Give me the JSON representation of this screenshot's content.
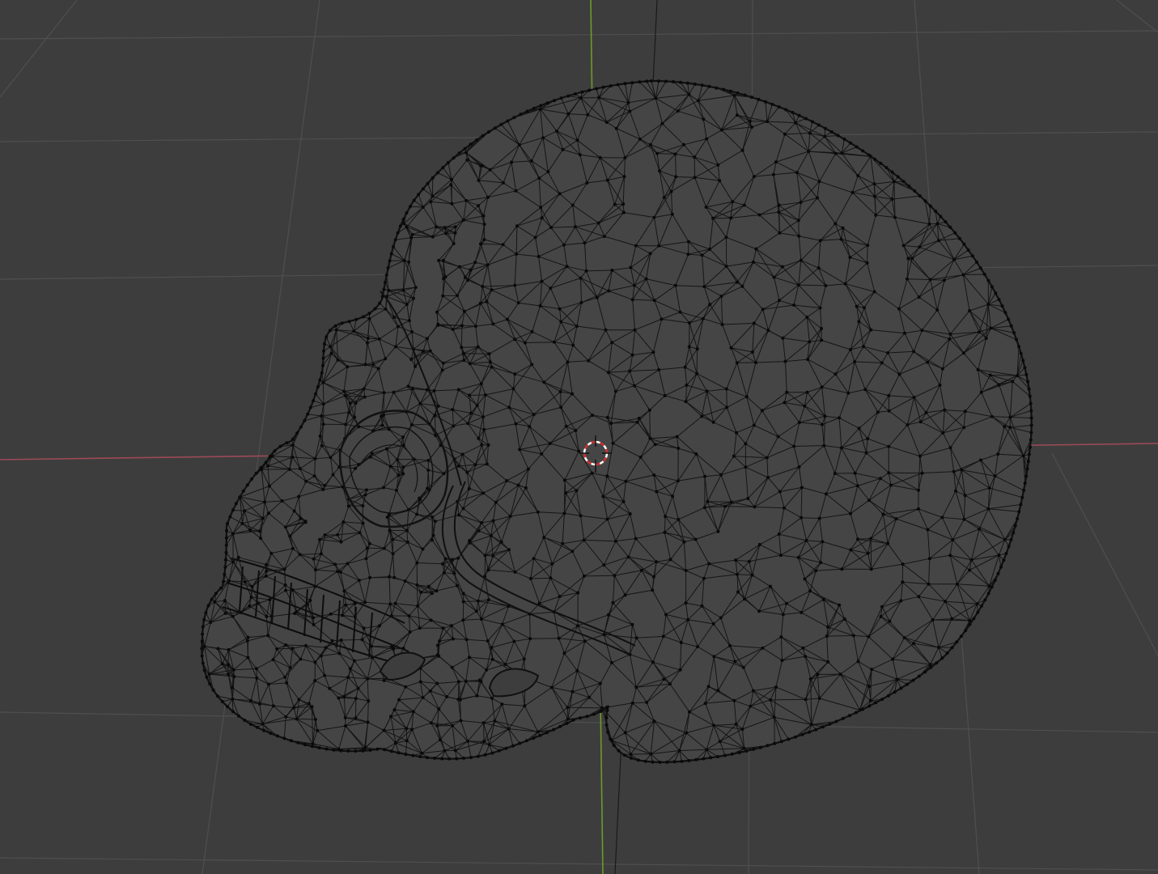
{
  "viewport": {
    "background": "#3d3d3d",
    "grid_color": "#4f4f4f",
    "x_axis_color": "#9c4a57",
    "y_axis_color": "#6d9a2a",
    "wire_color": "#151515",
    "vertex_color": "#0a0a0a",
    "mesh_fill": "#454545"
  },
  "object": {
    "name_icon": "skull-mesh",
    "display_mode": "wireframe"
  },
  "cursor": {
    "icon": "3d-cursor-icon",
    "ring_colors": [
      "#ffffff",
      "#d03030"
    ]
  }
}
